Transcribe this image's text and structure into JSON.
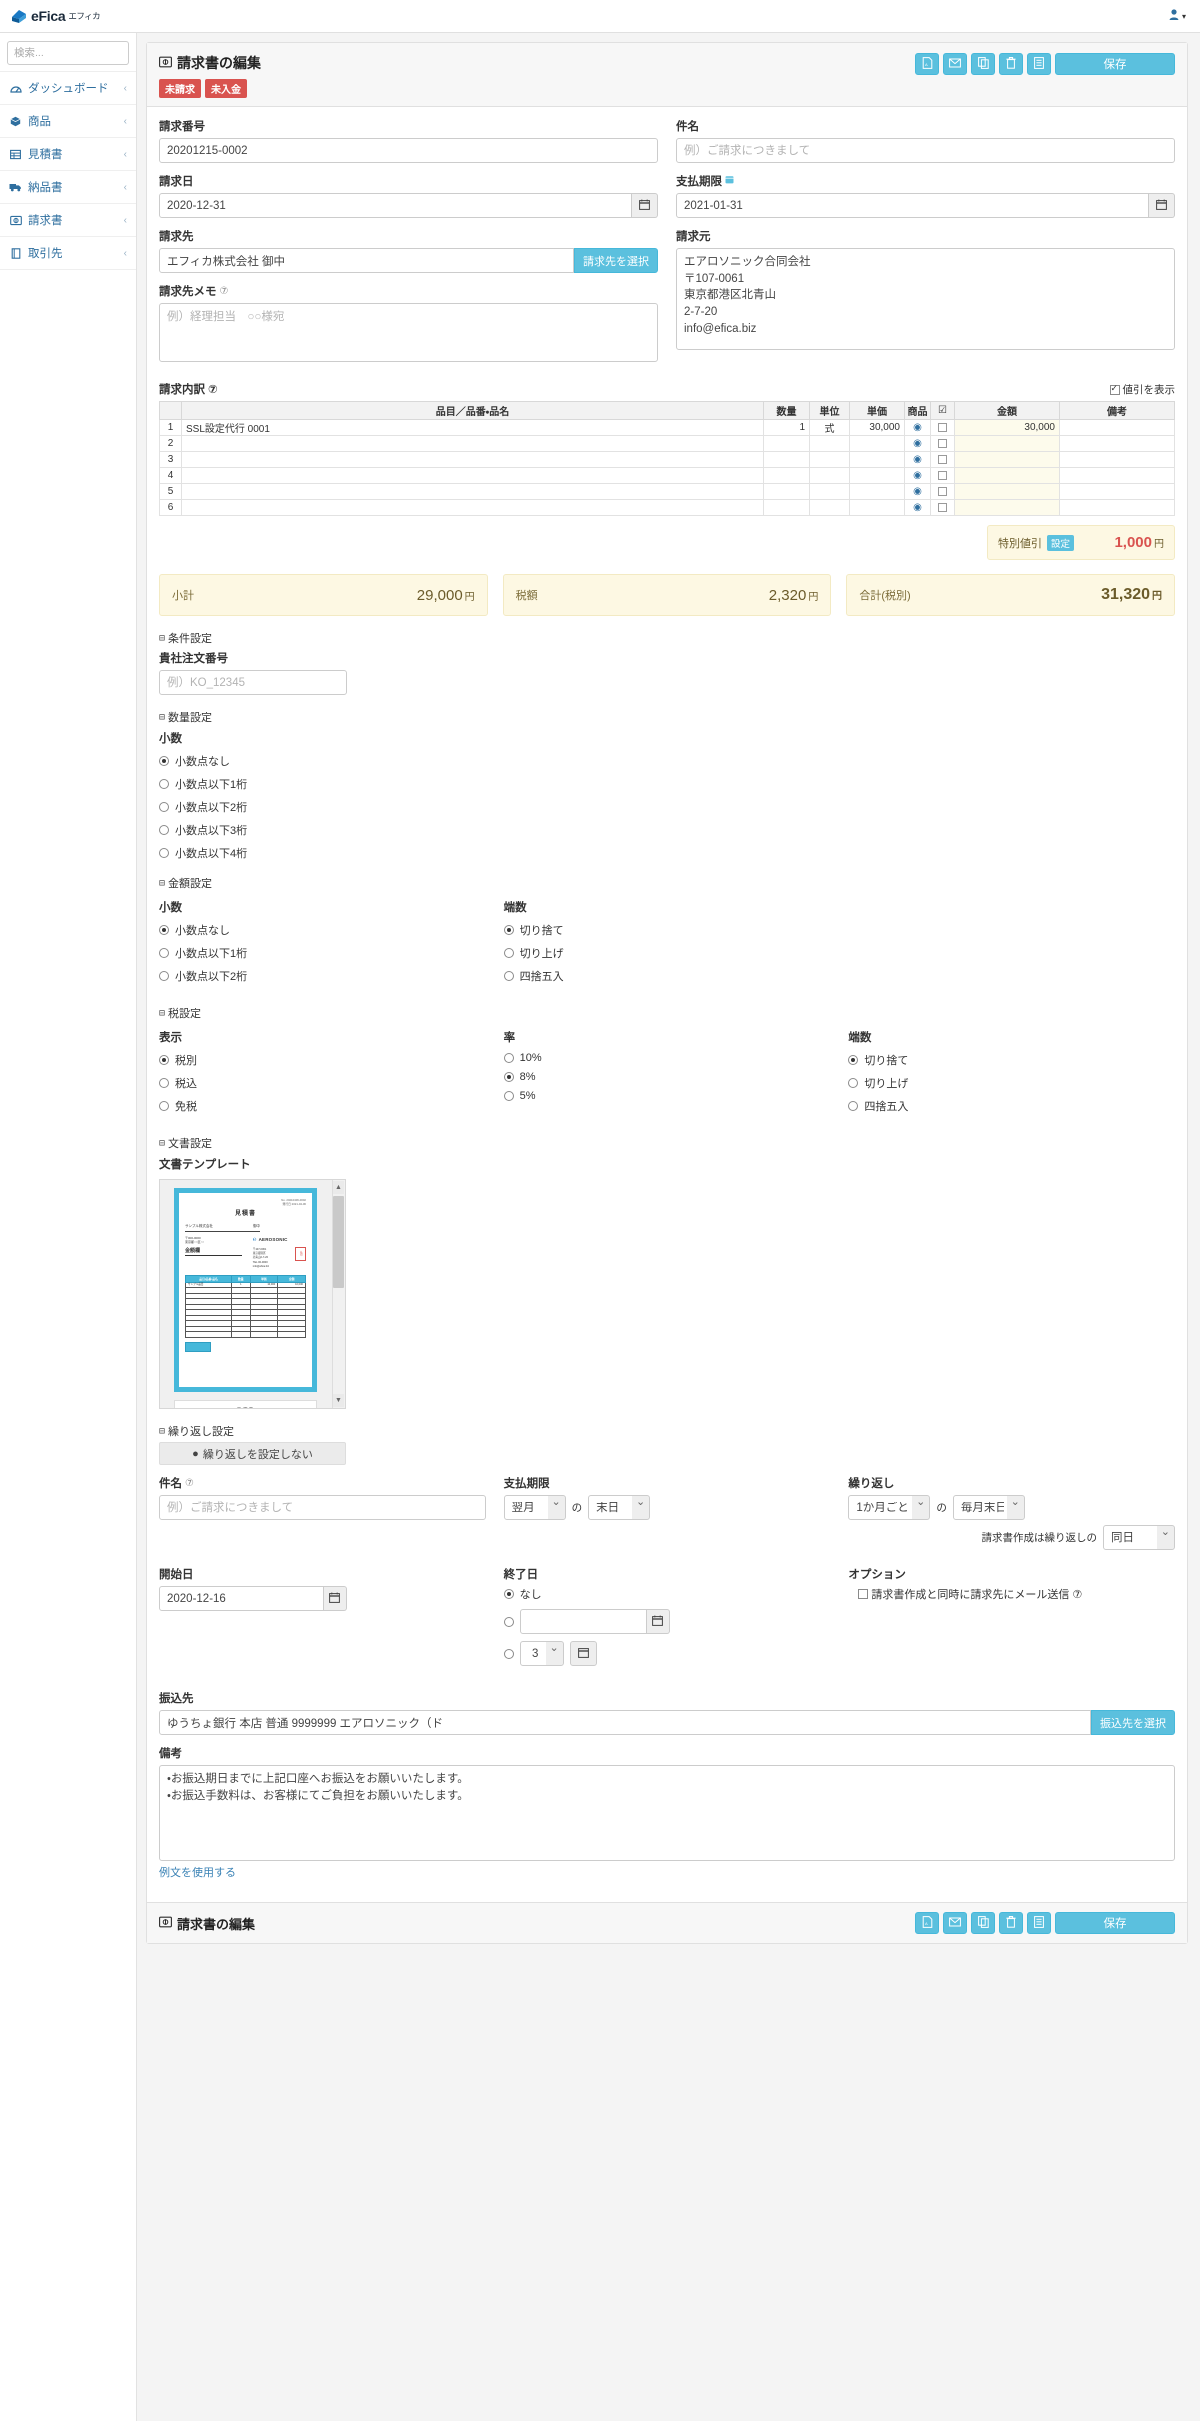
{
  "app": {
    "brand_name": "eFica",
    "brand_sub": "エフィカ",
    "user_icon": "user-icon"
  },
  "sidebar": {
    "search_placeholder": "検索...",
    "search_value": "",
    "items": [
      {
        "label": "ダッシュボード",
        "icon": "dashboard-icon"
      },
      {
        "label": "商品",
        "icon": "box-icon"
      },
      {
        "label": "見積書",
        "icon": "table-icon"
      },
      {
        "label": "納品書",
        "icon": "truck-icon"
      },
      {
        "label": "請求書",
        "icon": "invoice-icon"
      },
      {
        "label": "取引先",
        "icon": "book-icon"
      }
    ]
  },
  "header": {
    "title": "請求書の編集",
    "badges": [
      "未請求",
      "未入金"
    ],
    "save_label": "保存",
    "action_icons": [
      "pdf-icon",
      "mail-icon",
      "copy-icon",
      "trash-icon",
      "list-icon"
    ]
  },
  "form": {
    "invoice_no_label": "請求番号",
    "invoice_no_value": "20201215-0002",
    "subject_label": "件名",
    "subject_placeholder": "例）ご請求につきまして",
    "subject_value": "",
    "invoice_date_label": "請求日",
    "invoice_date_value": "2020-12-31",
    "due_date_label": "支払期限",
    "due_date_value": "2021-01-31",
    "bill_to_label": "請求先",
    "bill_to_value": "エフィカ株式会社 御中",
    "bill_to_select": "請求先を選択",
    "bill_to_memo_label": "請求先メモ",
    "bill_to_memo_placeholder": "例）経理担当　○○様宛",
    "bill_to_memo_value": "",
    "bill_from_label": "請求元",
    "bill_from_value": "エアロソニック合同会社\n〒107-0061\n東京都港区北青山\n2-7-20\ninfo@efica.biz"
  },
  "items": {
    "section_label": "請求内訳",
    "show_discount_label": "値引を表示",
    "show_discount_checked": true,
    "columns": [
      "",
      "品目／品番・品名",
      "数量",
      "単位",
      "単価",
      "商品",
      "☑",
      "金額",
      "備考"
    ],
    "rows": [
      {
        "no": "1",
        "name": "SSL設定代行 0001",
        "qty": "1",
        "unit": "式",
        "price": "30,000",
        "amount": "30,000",
        "note": ""
      },
      {
        "no": "2",
        "name": "",
        "qty": "",
        "unit": "",
        "price": "",
        "amount": "",
        "note": ""
      },
      {
        "no": "3",
        "name": "",
        "qty": "",
        "unit": "",
        "price": "",
        "amount": "",
        "note": ""
      },
      {
        "no": "4",
        "name": "",
        "qty": "",
        "unit": "",
        "price": "",
        "amount": "",
        "note": ""
      },
      {
        "no": "5",
        "name": "",
        "qty": "",
        "unit": "",
        "price": "",
        "amount": "",
        "note": ""
      },
      {
        "no": "6",
        "name": "",
        "qty": "",
        "unit": "",
        "price": "",
        "amount": "",
        "note": ""
      }
    ]
  },
  "totals": {
    "discount_label": "特別値引",
    "discount_tag": "設定",
    "discount_value": "1,000",
    "yen": "円",
    "subtotal_label": "小計",
    "subtotal_value": "29,000",
    "tax_label": "税額",
    "tax_value": "2,320",
    "grand_label": "合計(税別)",
    "grand_value": "31,320"
  },
  "conditions": {
    "section_label": "条件設定",
    "po_label": "貴社注文番号",
    "po_placeholder": "例）KO_12345",
    "po_value": ""
  },
  "qty_settings": {
    "section_label": "数量設定",
    "decimal_label": "小数",
    "options": [
      "小数点なし",
      "小数点以下1桁",
      "小数点以下2桁",
      "小数点以下3桁",
      "小数点以下4桁"
    ],
    "selected": 0
  },
  "amount_settings": {
    "section_label": "金額設定",
    "decimal_label": "小数",
    "decimal_options": [
      "小数点なし",
      "小数点以下1桁",
      "小数点以下2桁"
    ],
    "decimal_selected": 0,
    "round_label": "端数",
    "round_options": [
      "切り捨て",
      "切り上げ",
      "四捨五入"
    ],
    "round_selected": 0
  },
  "tax_settings": {
    "section_label": "税設定",
    "display_label": "表示",
    "display_options": [
      "税別",
      "税込",
      "免税"
    ],
    "display_selected": 0,
    "rate_label": "率",
    "rate_options": [
      "10%",
      "8%",
      "5%"
    ],
    "rate_selected": 1,
    "round_label": "端数",
    "round_options": [
      "切り捨て",
      "切り上げ",
      "四捨五入"
    ],
    "round_selected": 0
  },
  "doc_settings": {
    "section_label": "文書設定",
    "template_label": "文書テンプレート",
    "preview": {
      "doc_title": "見積書",
      "customer": "サンプル株式会社",
      "honorific": "御中",
      "company": "AEROSONIC",
      "stamp": "社印",
      "line1": "〒000-0000",
      "line2": "東京都○○区○○",
      "amount_label": "金額欄",
      "ref_no": "No. 20210406-0002",
      "ref_date": "発行日 2021-04-06",
      "cols": [
        "品目/品番・品名",
        "数量",
        "単価",
        "金額"
      ],
      "first_item": "サンプル品目",
      "first_qty": "1",
      "first_price": "10,000",
      "first_amount": "10,000"
    }
  },
  "repeat": {
    "section_label": "繰り返し設定",
    "tab_label": "繰り返しを設定しない",
    "subject_label": "件名",
    "subject_placeholder": "例）ご請求につきまして",
    "subject_value": "",
    "due_label": "支払期限",
    "due_month": "翌月",
    "due_joiner": "の",
    "due_day": "末日",
    "repeat_label": "繰り返し",
    "repeat_interval": "1か月ごと",
    "repeat_joiner": "の",
    "repeat_day": "毎月末日",
    "create_note": "請求書作成は繰り返しの",
    "create_day": "同日",
    "start_label": "開始日",
    "start_value": "2020-12-16",
    "end_label": "終了日",
    "end_none": "なし",
    "end_date_value": "",
    "end_count_value": "3",
    "options_label": "オプション",
    "option_mail": "請求書作成と同時に請求先にメール送信"
  },
  "bank": {
    "label": "振込先",
    "value": "ゆうちょ銀行 本店 普通 9999999 エアロソニック（ド",
    "select_label": "振込先を選択"
  },
  "remarks": {
    "label": "備考",
    "value": "・お振込期日までに上記口座へお振込をお願いいたします。\n・お振込手数料は、お客様にてご負担をお願いいたします。",
    "example_link": "例文を使用する"
  },
  "footer": {
    "title": "請求書の編集",
    "save_label": "保存"
  },
  "colors": {
    "accent": "#5bc0de",
    "danger": "#d9534f",
    "link": "#3a82b5",
    "money_bg": "#fdf8e3"
  }
}
